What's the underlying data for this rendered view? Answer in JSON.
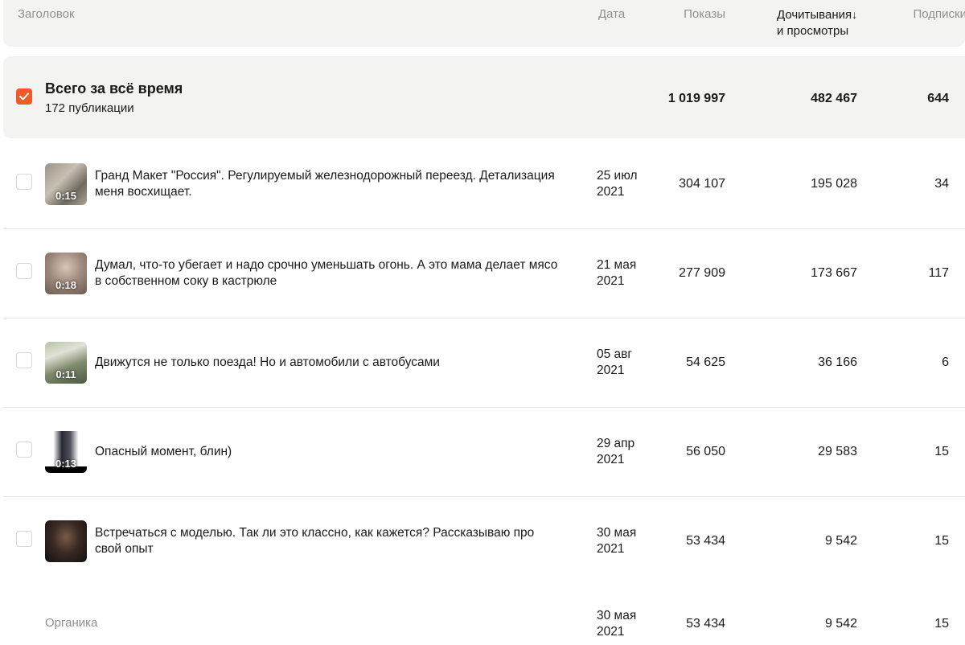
{
  "header": {
    "title": "Заголовок",
    "date": "Дата",
    "shows": "Показы",
    "reads_line1": "Дочитывания",
    "reads_arrow": "↓",
    "reads_line2": "и просмотры",
    "subs": "Подписки"
  },
  "total": {
    "title": "Всего за всё время",
    "subtitle": "172 публикации",
    "shows": "1 019 997",
    "reads": "482 467",
    "subs": "644"
  },
  "rows": [
    {
      "title_l1": "Гранд Макет \"Россия\". Регулируемый железнодорожный переезд. Детализация",
      "title_l2": "меня восхищает.",
      "duration": "0:15",
      "date_l1": "25 июл",
      "date_l2": "2021",
      "shows": "304 107",
      "reads": "195 028",
      "subs": "34"
    },
    {
      "title_l1": "Думал, что-то убегает и надо срочно уменьшать огонь. А это мама делает мясо",
      "title_l2": "в собственном соку в кастрюле",
      "duration": "0:18",
      "date_l1": "21 мая",
      "date_l2": "2021",
      "shows": "277 909",
      "reads": "173 667",
      "subs": "117"
    },
    {
      "title_l1": "Движутся не только поезда! Но и автомобили с автобусами",
      "title_l2": "",
      "duration": "0:11",
      "date_l1": "05 авг",
      "date_l2": "2021",
      "shows": "54 625",
      "reads": "36 166",
      "subs": "6"
    },
    {
      "title_l1": "Опасный момент, блин)",
      "title_l2": "",
      "duration": "0:13",
      "date_l1": "29 апр",
      "date_l2": "2021",
      "shows": "56 050",
      "reads": "29 583",
      "subs": "15"
    },
    {
      "title_l1": "Встречаться с моделью. Так ли это классно, как кажется? Рассказываю про",
      "title_l2": "свой опыт",
      "duration": "",
      "date_l1": "30 мая",
      "date_l2": "2021",
      "shows": "53 434",
      "reads": "9 542",
      "subs": "15"
    }
  ],
  "organic": {
    "label": "Органика",
    "date_l1": "30 мая",
    "date_l2": "2021",
    "shows": "53 434",
    "reads": "9 542",
    "subs": "15"
  }
}
